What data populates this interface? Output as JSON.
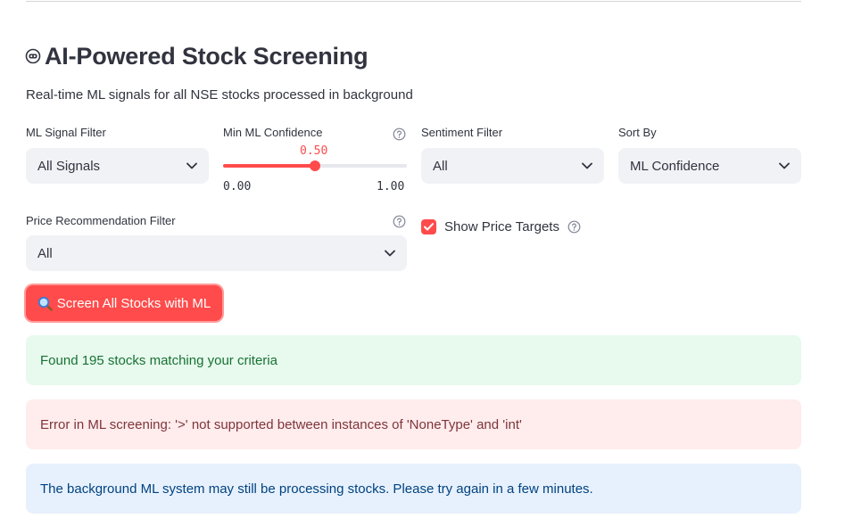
{
  "header": {
    "title": "AI-Powered Stock Screening",
    "subtitle": "Real-time ML signals for all NSE stocks processed in background"
  },
  "filters": {
    "ml_signal": {
      "label": "ML Signal Filter",
      "value": "All Signals"
    },
    "min_confidence": {
      "label": "Min ML Confidence",
      "value": "0.50",
      "min": "0.00",
      "max": "1.00",
      "fraction": 0.5
    },
    "sentiment": {
      "label": "Sentiment Filter",
      "value": "All"
    },
    "sort_by": {
      "label": "Sort By",
      "value": "ML Confidence"
    },
    "price_recommendation": {
      "label": "Price Recommendation Filter",
      "value": "All"
    },
    "show_price_targets": {
      "label": "Show Price Targets",
      "checked": true
    }
  },
  "actions": {
    "screen_button": "Screen All Stocks with ML"
  },
  "alerts": {
    "success": "Found 195 stocks matching your criteria",
    "error": "Error in ML screening: '>' not supported between instances of 'NoneType' and 'int'",
    "info": "The background ML system may still be processing stocks. Please try again in a few minutes."
  },
  "colors": {
    "primary": "#ff4b4b",
    "success_bg": "#e8f9ee",
    "error_bg": "#ffecec",
    "info_bg": "#e7f1fd"
  },
  "icons": {
    "title": "robot-icon",
    "help": "question-circle-icon",
    "dropdown": "chevron-down-icon",
    "button": "magnifier-icon"
  }
}
